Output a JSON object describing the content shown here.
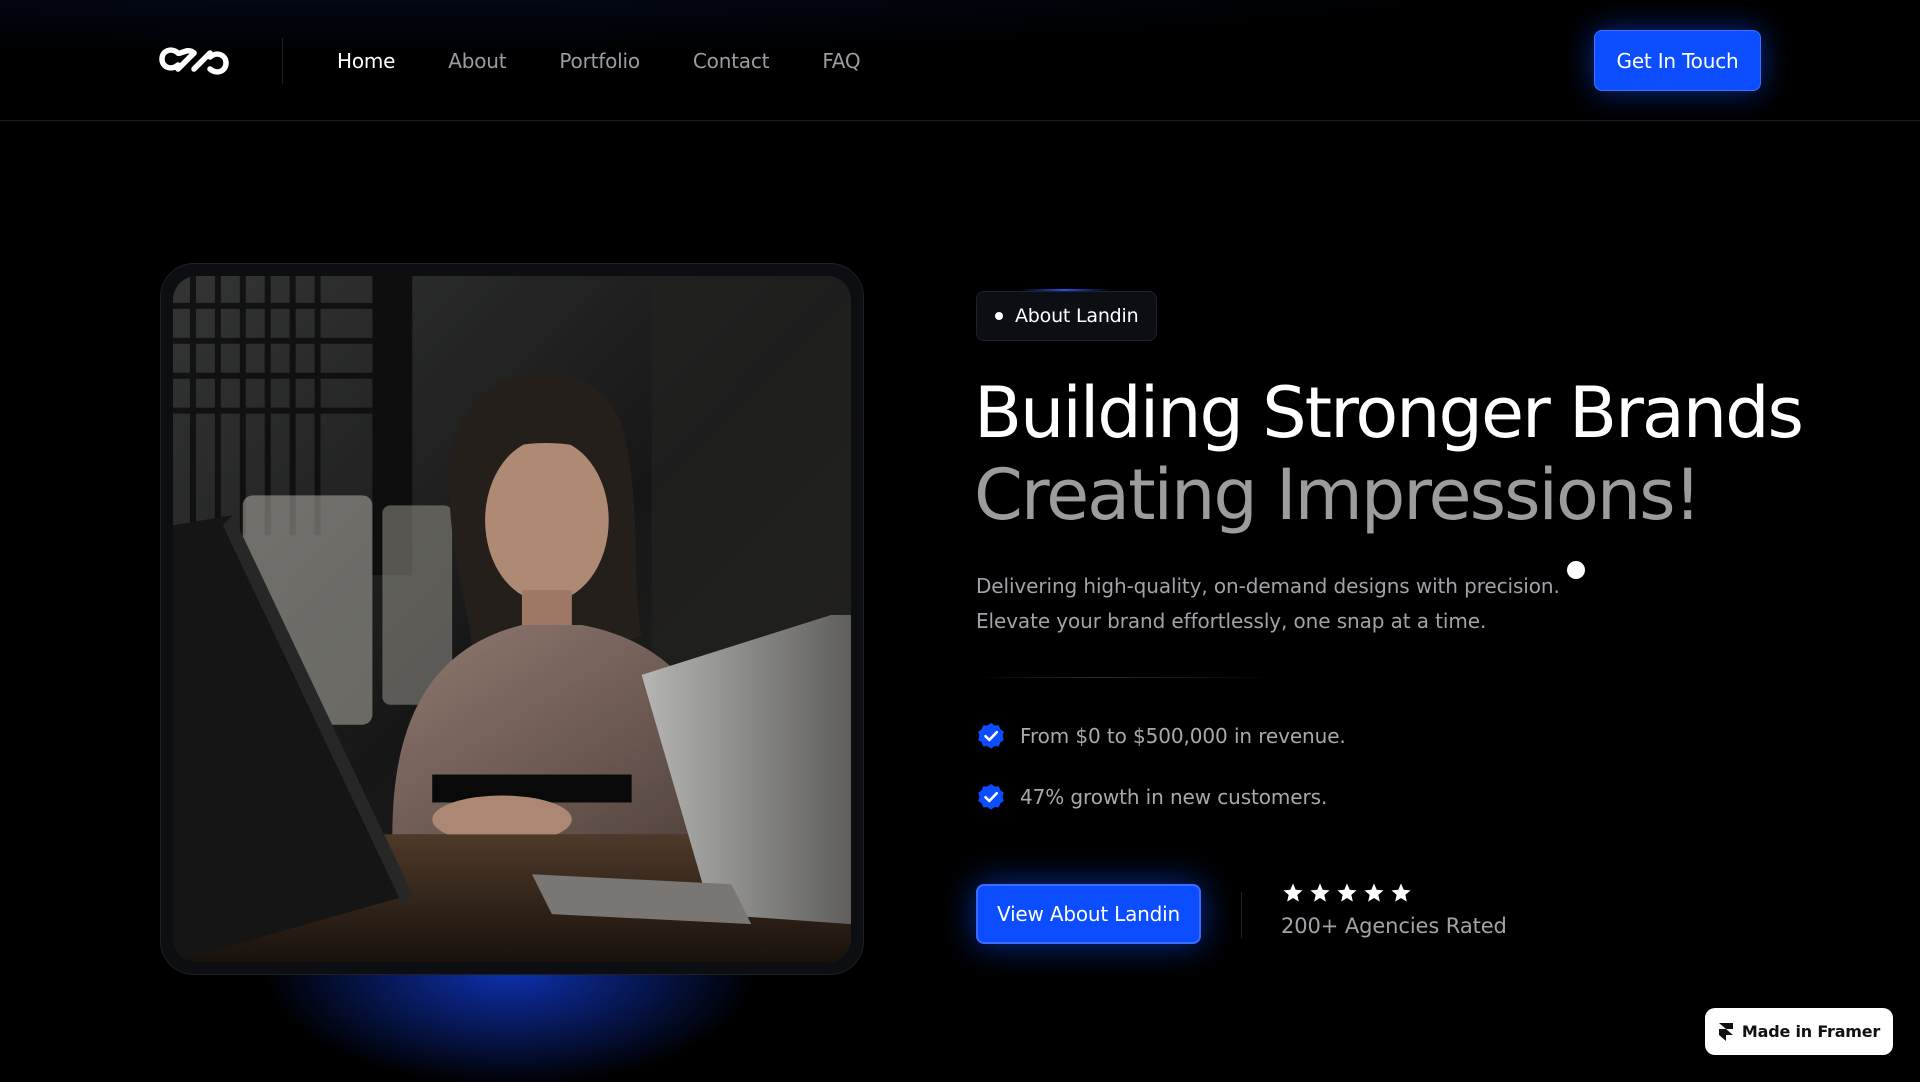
{
  "nav": {
    "logo_name": "landin-logo",
    "links": [
      {
        "label": "Home",
        "active": true
      },
      {
        "label": "About",
        "active": false
      },
      {
        "label": "Portfolio",
        "active": false
      },
      {
        "label": "Contact",
        "active": false
      },
      {
        "label": "FAQ",
        "active": false
      }
    ],
    "cta_label": "Get In Touch"
  },
  "hero": {
    "image_alt": "Woman working at a laptop",
    "pill_label": "About Landin",
    "headline_line1": "Building Stronger Brands",
    "headline_line2": "Creating Impressions!",
    "description_line1": "Delivering high-quality, on-demand designs with precision.",
    "description_line2": "Elevate your brand effortlessly, one snap at a time.",
    "features": [
      {
        "icon": "verified-badge-icon",
        "text": "From $0 to $500,000 in revenue."
      },
      {
        "icon": "verified-badge-icon",
        "text": "47% growth in new customers."
      }
    ],
    "cta_label": "View About Landin",
    "rating": {
      "stars": 5,
      "label": "200+ Agencies Rated"
    }
  },
  "framer_badge": {
    "label": "Made in Framer"
  },
  "colors": {
    "background": "#000000",
    "accent": "#0b4dff",
    "muted_text": "#9c9c9c",
    "primary_text": "#ffffff"
  }
}
